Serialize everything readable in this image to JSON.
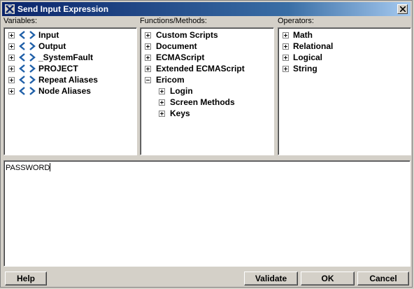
{
  "window": {
    "title": "Send Input Expression"
  },
  "variables": {
    "label": "Variables:",
    "items": [
      {
        "label": "Input"
      },
      {
        "label": "Output"
      },
      {
        "label": "_SystemFault"
      },
      {
        "label": "PROJECT"
      },
      {
        "label": "Repeat Aliases"
      },
      {
        "label": "Node Aliases"
      }
    ]
  },
  "functions": {
    "label": "Functions/Methods:",
    "items": [
      {
        "label": "Custom Scripts"
      },
      {
        "label": "Document"
      },
      {
        "label": "ECMAScript"
      },
      {
        "label": "Extended ECMAScript"
      },
      {
        "label": "Ericom"
      },
      {
        "label": "Login"
      },
      {
        "label": "Screen Methods"
      },
      {
        "label": "Keys"
      }
    ]
  },
  "operators": {
    "label": "Operators:",
    "items": [
      {
        "label": "Math"
      },
      {
        "label": "Relational"
      },
      {
        "label": "Logical"
      },
      {
        "label": "String"
      }
    ]
  },
  "editor": {
    "value": "PASSWORD"
  },
  "buttons": {
    "help": "Help",
    "validate": "Validate",
    "ok": "OK",
    "cancel": "Cancel"
  },
  "colors": {
    "title_start": "#0a246a",
    "title_end": "#a6caf0",
    "variable_icon": "#1f5fa8",
    "face": "#d4d0c8"
  }
}
